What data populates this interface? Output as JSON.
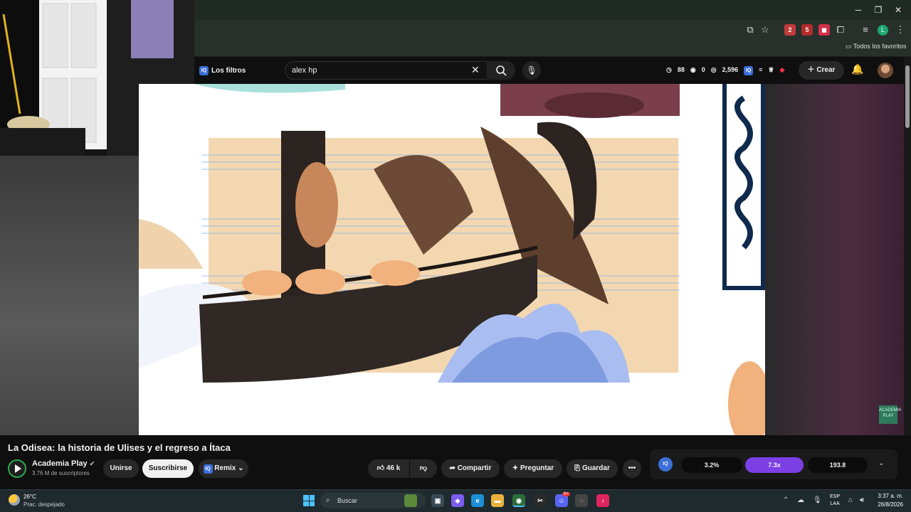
{
  "browser": {
    "window_controls": {
      "minimize": "─",
      "maximize": "❐",
      "close": "✕"
    },
    "bookmarks_label": "Todos los favoritos",
    "profile_initial": "L",
    "extension_badges": [
      "2",
      "5"
    ]
  },
  "header": {
    "filters_label": "Los filtros",
    "iq_badge": "IQ",
    "search_value": "alex hp",
    "stats": {
      "time": "88",
      "views_hidden": "0",
      "views": "2,596"
    },
    "create_label": "Crear"
  },
  "video": {
    "title": "La Odisea: la historia de Ulises y el regreso a Ítaca",
    "channel_name": "Academia Play",
    "subscribers": "3.76 M de suscriptores",
    "join_label": "Unirse",
    "subscribe_label": "Suscribirse",
    "remix_label": "Remix",
    "likes": "46 k",
    "share_label": "Compartir",
    "ask_label": "Preguntar",
    "save_label": "Guardar",
    "watermark": "ACADEMIA PLAY"
  },
  "iq_metrics": {
    "ratio": "3.2%",
    "multiplier": "7.3x",
    "score": "193.8"
  },
  "taskbar": {
    "weather_temp": "26°C",
    "weather_desc": "Prac. despejado",
    "search_placeholder": "Buscar",
    "lang_top": "ESP",
    "lang_bottom": "LAA",
    "time": "3:37 a. m.",
    "date": "26/8/2026",
    "notification_badge": "9+"
  },
  "colors": {
    "accent_purple": "#7b3fe4",
    "iq_blue": "#3b6fd9",
    "subscribe_bg": "#f1f1f1"
  }
}
